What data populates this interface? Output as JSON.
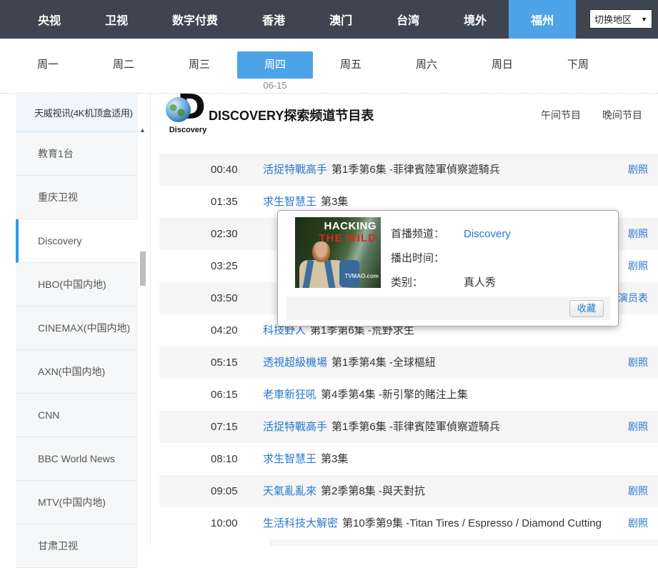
{
  "top_nav": {
    "items": [
      "央视",
      "卫视",
      "数字付费",
      "香港",
      "澳门",
      "台湾",
      "境外",
      "福州"
    ],
    "active": "福州",
    "region_select_label": "切换地区"
  },
  "day_nav": {
    "items": [
      "周一",
      "周二",
      "周三",
      "周四",
      "周五",
      "周六",
      "周日",
      "下周"
    ],
    "active": "周四",
    "active_date": "06-15"
  },
  "sidebar": {
    "header": "天威视讯(4K机顶盒适用)",
    "selected": "Discovery",
    "channels": [
      "教育1台",
      "重庆卫视",
      "Discovery",
      "HBO(中国内地)",
      "CINEMAX(中国内地)",
      "AXN(中国内地)",
      "CNN",
      "BBC World News",
      "MTV(中国内地)",
      "甘肃卫视"
    ]
  },
  "content": {
    "logo_text": "Discovery",
    "title": "DISCOVERY探索频道节目表",
    "header_links": [
      "午间节目",
      "晚间节目"
    ],
    "schedule": [
      {
        "time": "00:40",
        "title": "活捉特戰高手",
        "episode": "第1季第6集 -菲律賓陸軍偵察遊騎兵",
        "link": "剧照"
      },
      {
        "time": "01:35",
        "title": "求生智慧王",
        "episode": "第3集",
        "link": ""
      },
      {
        "time": "02:30",
        "title": "",
        "episode": "",
        "link": "剧照"
      },
      {
        "time": "03:25",
        "title": "",
        "episode": "",
        "link": "剧照"
      },
      {
        "time": "03:50",
        "title": "",
        "episode": "",
        "link": "演员表"
      },
      {
        "time": "04:20",
        "title": "科技野人",
        "episode": "第1季第6集 -荒野求生",
        "link": ""
      },
      {
        "time": "05:15",
        "title": "透視超級機場",
        "episode": "第1季第4集 -全球樞紐",
        "link": "剧照"
      },
      {
        "time": "06:15",
        "title": "老車新狂吼",
        "episode": "第4季第4集 -新引擎的賭注上集",
        "link": ""
      },
      {
        "time": "07:15",
        "title": "活捉特戰高手",
        "episode": "第1季第6集 -菲律賓陸軍偵察遊騎兵",
        "link": "剧照"
      },
      {
        "time": "08:10",
        "title": "求生智慧王",
        "episode": "第3集",
        "link": ""
      },
      {
        "time": "09:05",
        "title": "天氣亂亂來",
        "episode": "第2季第8集 -與天對抗",
        "link": "剧照"
      },
      {
        "time": "10:00",
        "title": "生活科技大解密",
        "episode": "第10季第9集 -Titan Tires / Espresso / Diamond Cutting",
        "link": "剧照"
      }
    ]
  },
  "popup": {
    "poster": {
      "line1": "HACKING",
      "line2": "THE WILD",
      "watermark": "TVMAO.com"
    },
    "fields": [
      {
        "label": "首播频道：",
        "value": "Discovery",
        "is_link": true
      },
      {
        "label": "播出时间：",
        "value": "",
        "is_link": false
      },
      {
        "label": "类别：",
        "value": "真人秀",
        "is_link": false
      }
    ],
    "favorite_label": "收藏"
  },
  "colors": {
    "accent": "#4da3e8",
    "link": "#2878cf",
    "nav_bg": "#3e4550",
    "row_alt": "#f5f5f5"
  }
}
